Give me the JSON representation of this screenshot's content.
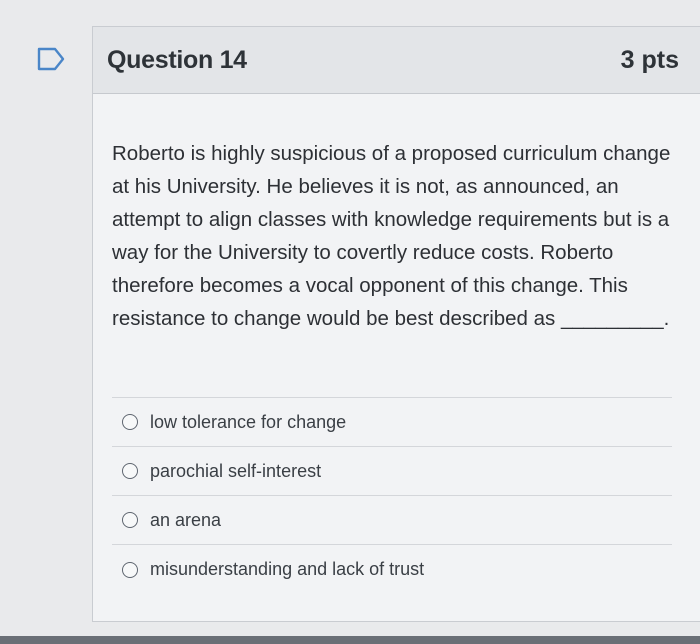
{
  "question": {
    "flag_icon": "bookmark-flag-icon",
    "title": "Question 14",
    "points": "3 pts",
    "text": "Roberto is highly suspicious of a proposed curriculum change at his University. He believes it is not, as announced, an attempt to align classes with knowledge requirements but is a way for the University to covertly reduce costs. Roberto therefore becomes a vocal opponent of this change. This resistance to change would be best described as _________.",
    "answers": [
      {
        "label": "low tolerance for change"
      },
      {
        "label": "parochial self-interest"
      },
      {
        "label": "an arena"
      },
      {
        "label": "misunderstanding and lack of trust"
      }
    ]
  }
}
